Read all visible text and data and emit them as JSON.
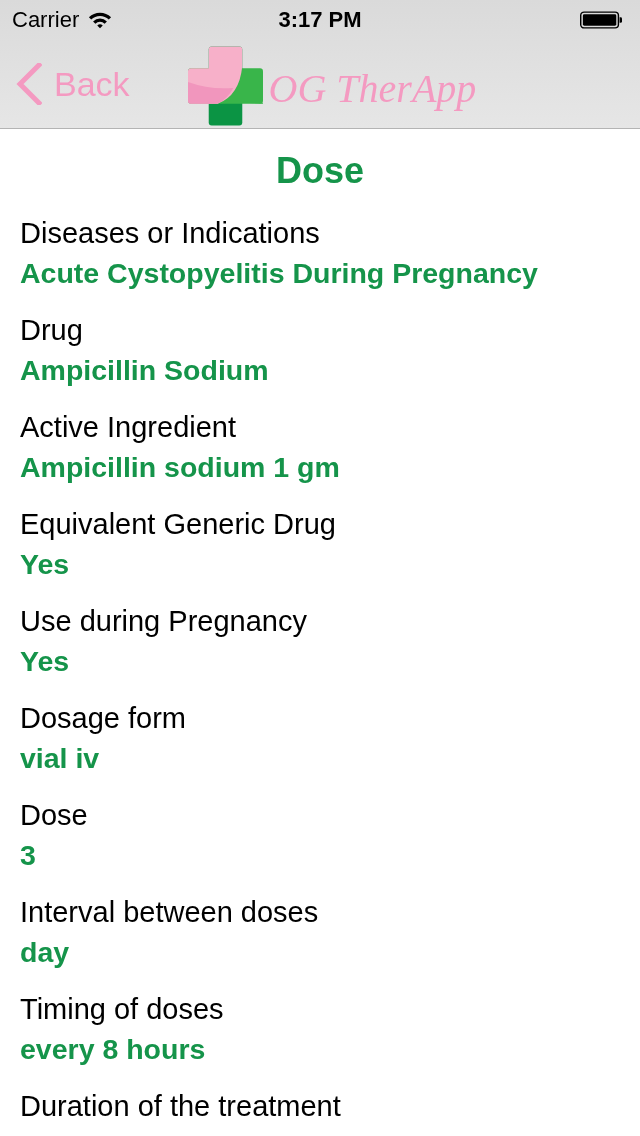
{
  "status_bar": {
    "carrier": "Carrier",
    "time": "3:17 PM"
  },
  "nav_bar": {
    "back_label": "Back",
    "logo_text": "OG TherApp"
  },
  "title": "Dose",
  "fields": [
    {
      "label": "Diseases or Indications",
      "value": "Acute Cystopyelitis During Pregnancy"
    },
    {
      "label": "Drug",
      "value": "Ampicillin Sodium"
    },
    {
      "label": "Active Ingredient",
      "value": "Ampicillin sodium 1 gm"
    },
    {
      "label": "Equivalent Generic Drug",
      "value": "Yes"
    },
    {
      "label": "Use during Pregnancy",
      "value": "Yes"
    },
    {
      "label": "Dosage form",
      "value": "vial iv"
    },
    {
      "label": "Dose",
      "value": "3"
    },
    {
      "label": "Interval between doses",
      "value": "day"
    },
    {
      "label": "Timing of doses",
      "value": "every 8 hours"
    },
    {
      "label": "Duration of the treatment"
    }
  ]
}
